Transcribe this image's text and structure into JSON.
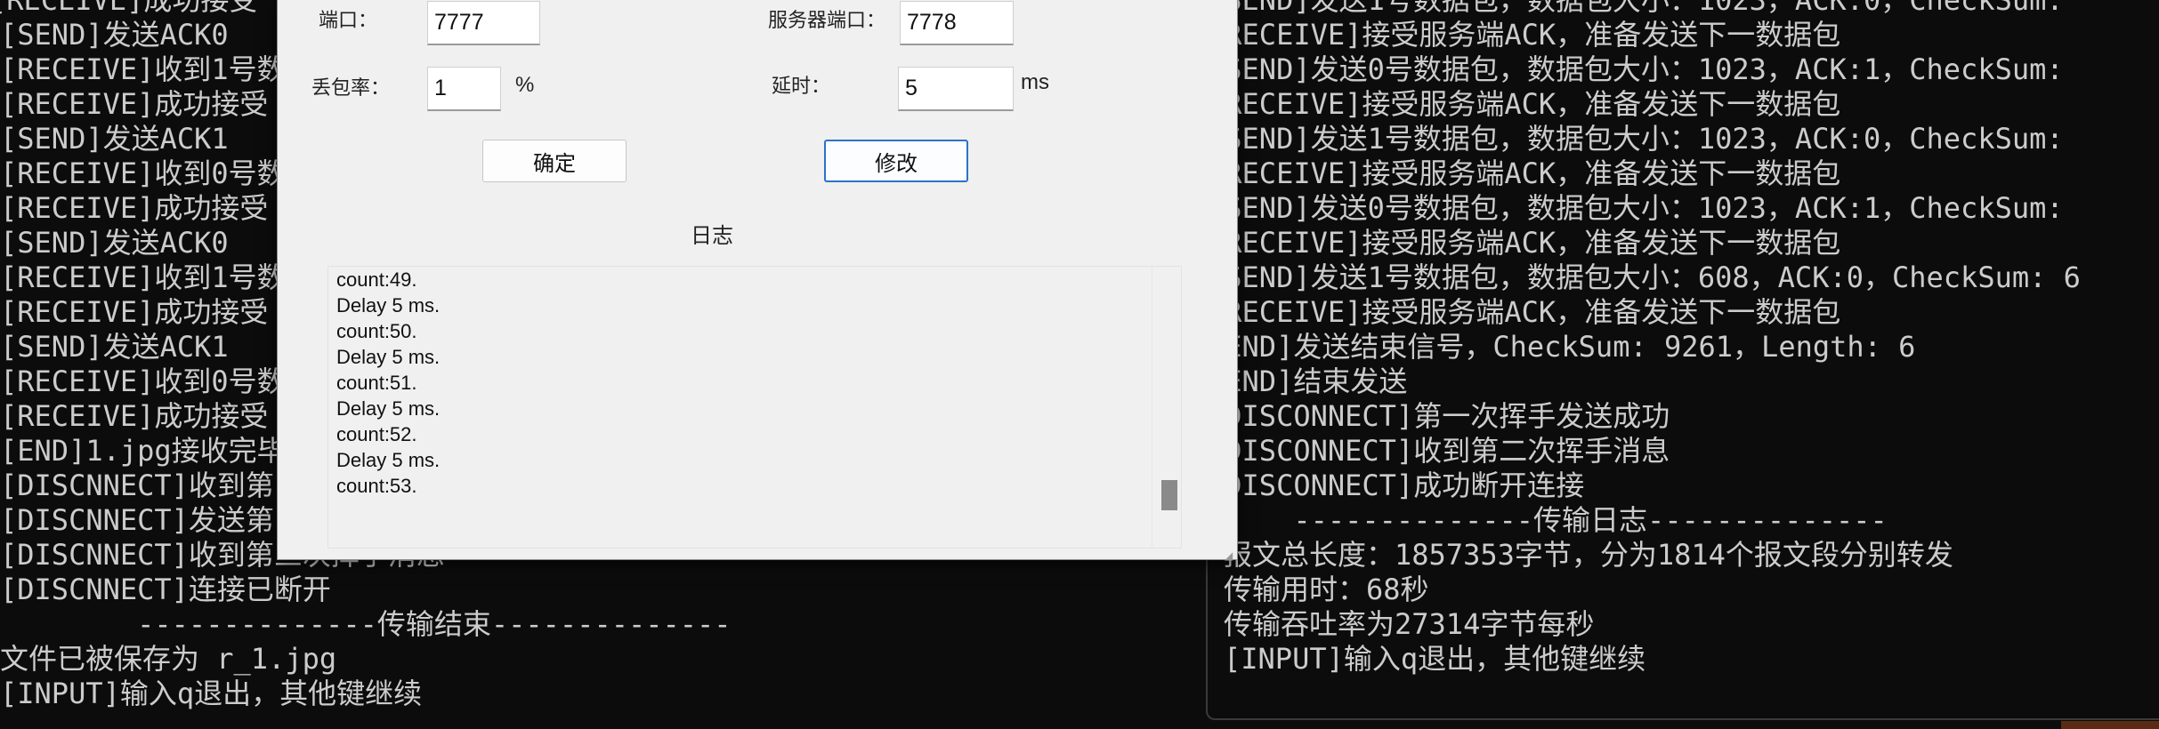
{
  "left_console": {
    "lines": [
      "[RECEIVE]成功接受",
      "[SEND]发送ACK0",
      "[RECEIVE]收到1号数",
      "[RECEIVE]成功接受",
      "[SEND]发送ACK1",
      "[RECEIVE]收到0号数",
      "[RECEIVE]成功接受",
      "[SEND]发送ACK0",
      "[RECEIVE]收到1号数",
      "[RECEIVE]成功接受",
      "[SEND]发送ACK1",
      "[RECEIVE]收到0号数",
      "[RECEIVE]成功接受",
      "[END]1.jpg接收完毕",
      "[DISCNNECT]收到第",
      "[DISCNNECT]发送第",
      "[DISCNNECT]收到第三次挥手消息",
      "[DISCNNECT]连接已断开",
      "        --------------传输结束--------------",
      "文件已被保存为 r_1.jpg",
      "[INPUT]输入q退出，其他键继续"
    ]
  },
  "right_console": {
    "lines": [
      "[SEND]发送1号数据包，数据包大小：1023，ACK:0，CheckSum:",
      "[RECEIVE]接受服务端ACK，准备发送下一数据包",
      "[SEND]发送0号数据包，数据包大小：1023，ACK:1，CheckSum:",
      "[RECEIVE]接受服务端ACK，准备发送下一数据包",
      "[SEND]发送1号数据包，数据包大小：1023，ACK:0，CheckSum:",
      "[RECEIVE]接受服务端ACK，准备发送下一数据包",
      "[SEND]发送0号数据包，数据包大小：1023，ACK:1，CheckSum:",
      "[RECEIVE]接受服务端ACK，准备发送下一数据包",
      "[SEND]发送1号数据包，数据包大小：608，ACK:0，CheckSum: 6",
      "[RECEIVE]接受服务端ACK，准备发送下一数据包",
      "[END]发送结束信号，CheckSum: 9261，Length: 6",
      "[END]结束发送",
      "[DISCONNECT]第一次挥手发送成功",
      "[DISCONNECT]收到第二次挥手消息",
      "[DISCONNECT]成功断开连接",
      "     --------------传输日志--------------",
      "报文总长度：1857353字节，分为1814个报文段分别转发",
      "传输用时：68秒",
      "传输吞吐率为27314字节每秒",
      "[INPUT]输入q退出，其他键继续"
    ]
  },
  "dialog": {
    "port_label": "端口：",
    "port_value": "7777",
    "server_port_label": "服务器端口：",
    "server_port_value": "7778",
    "loss_label": "丢包率：",
    "loss_value": "1",
    "loss_unit": "%",
    "delay_label": "延时：",
    "delay_value": "5",
    "delay_unit": "ms",
    "confirm_label": "确定",
    "modify_label": "修改",
    "log_title": "日志",
    "log_lines": [
      "count:49.",
      "Delay 5 ms.",
      "count:50.",
      "Delay 5 ms.",
      "count:51.",
      "Delay 5 ms.",
      "count:52.",
      "Delay 5 ms.",
      "count:53."
    ]
  },
  "colors": {
    "console_bg": "#0c0c0c",
    "console_text": "#cccccc",
    "dialog_bg": "#f0f0f0",
    "primary_button_border": "#2b73c8"
  }
}
